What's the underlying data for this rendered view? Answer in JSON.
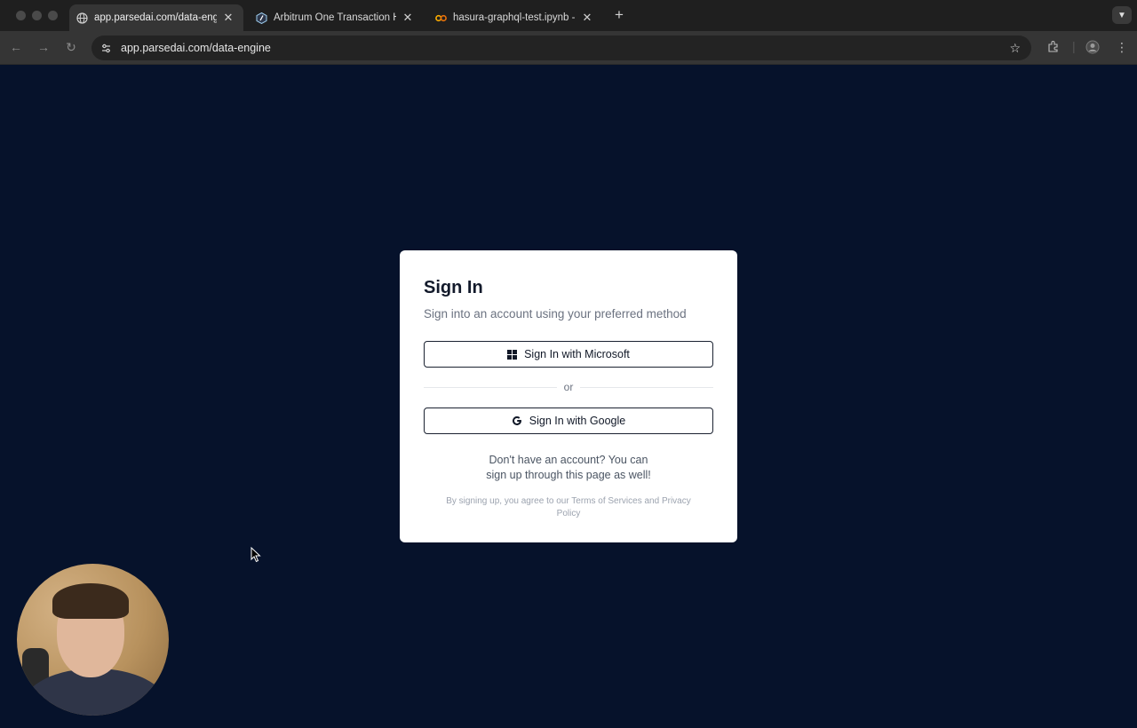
{
  "browser": {
    "tabs": [
      {
        "title": "app.parsedai.com/data-engin",
        "active": true,
        "favicon": "globe-icon"
      },
      {
        "title": "Arbitrum One Transaction Ha",
        "active": false,
        "favicon": "arbitrum-logo-icon"
      },
      {
        "title": "hasura-graphql-test.ipynb - C",
        "active": false,
        "favicon": "colab-logo-icon"
      }
    ],
    "url": "app.parsedai.com/data-engine"
  },
  "signin": {
    "title": "Sign In",
    "subtitle": "Sign into an account using your preferred method",
    "microsoft_button": "Sign In with Microsoft",
    "divider": "or",
    "google_button": "Sign In with Google",
    "signup_line1": "Don't have an account? You can",
    "signup_line2": "sign up through this page as well!",
    "terms_line1": "By signing up, you agree to our Terms of Services and Privacy",
    "terms_line2": "Policy"
  },
  "colors": {
    "page_background": "#06122b",
    "card_background": "#ffffff",
    "browser_chrome": "#353535"
  }
}
